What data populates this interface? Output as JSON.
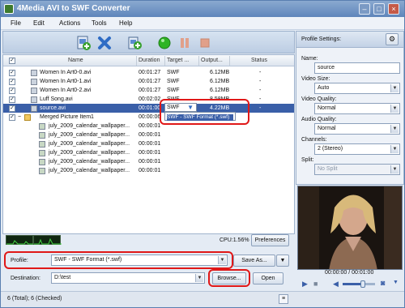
{
  "window": {
    "title": "4Media AVI to SWF Converter"
  },
  "menu": [
    "File",
    "Edit",
    "Actions",
    "Tools",
    "Help"
  ],
  "icons": {
    "add_file": "add-file-icon",
    "remove": "remove-icon",
    "add_folder": "add-folder-icon",
    "start": "start-icon",
    "pause": "pause-icon",
    "stop": "stop-icon"
  },
  "list": {
    "columns": [
      "Name",
      "Duration",
      "Target ...",
      "Output...",
      "Status"
    ],
    "rows": [
      {
        "name": "Women In Art0-0.avi",
        "duration": "00:01:27",
        "target": "SWF",
        "output": "6.12MB",
        "status": "-"
      },
      {
        "name": "Women In Art0-1.avi",
        "duration": "00:01:27",
        "target": "SWF",
        "output": "6.12MB",
        "status": "-"
      },
      {
        "name": "Women In Art0-2.avi",
        "duration": "00:01:27",
        "target": "SWF",
        "output": "6.12MB",
        "status": "-"
      },
      {
        "name": "Luff Song.avi",
        "duration": "00:02:02",
        "target": "SWF",
        "output": "8.58MB",
        "status": "-"
      },
      {
        "name": "source.avi",
        "duration": "00:01:00",
        "target": "SWF",
        "output": "4.22MB",
        "status": "-"
      },
      {
        "name": "Merged Picture Item1",
        "duration": "00:00:06",
        "target": "",
        "output": "",
        "status": ""
      },
      {
        "name": "july_2009_calendar_wallpaper...",
        "duration": "00:00:01",
        "target": "",
        "output": "",
        "status": ""
      },
      {
        "name": "july_2009_calendar_wallpaper...",
        "duration": "00:00:01",
        "target": "",
        "output": "",
        "status": ""
      },
      {
        "name": "july_2009_calendar_wallpaper...",
        "duration": "00:00:01",
        "target": "",
        "output": "",
        "status": ""
      },
      {
        "name": "july_2009_calendar_wallpaper...",
        "duration": "00:00:01",
        "target": "",
        "output": "",
        "status": ""
      },
      {
        "name": "july_2009_calendar_wallpaper...",
        "duration": "00:00:01",
        "target": "",
        "output": "",
        "status": ""
      },
      {
        "name": "july_2009_calendar_wallpaper...",
        "duration": "00:00:01",
        "target": "",
        "output": "",
        "status": ""
      }
    ],
    "dropdown_option": "SWF - SWF Format (*.swf)"
  },
  "cpu": "CPU:1.56%",
  "buttons": {
    "preferences": "Preferences",
    "save_as": "Save As...",
    "browse": "Browse...",
    "open": "Open"
  },
  "profile": {
    "label": "Profile:",
    "value": "SWF - SWF Format (*.swf)"
  },
  "destination": {
    "label": "Destination:",
    "value": "D:\\test"
  },
  "status": "6 (Total); 6 (Checked)",
  "settings": {
    "header": "Profile Settings:",
    "name_label": "Name:",
    "name_value": "source",
    "video_size_label": "Video Size:",
    "video_size_value": "Auto",
    "video_quality_label": "Video Quality:",
    "video_quality_value": "Normal",
    "audio_quality_label": "Audio Quality:",
    "audio_quality_value": "Normal",
    "channels_label": "Channels:",
    "channels_value": "2 (Stereo)",
    "split_label": "Split:",
    "split_value": "No Split"
  },
  "preview": {
    "time": "00:00:00 / 00:01:00"
  },
  "colors": {
    "highlight_ring": "#e01818",
    "selection": "#3a5fa8"
  }
}
